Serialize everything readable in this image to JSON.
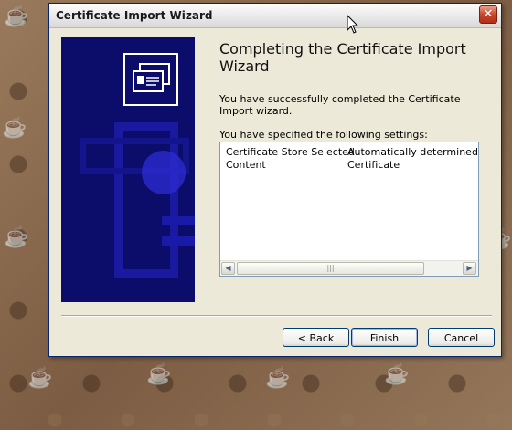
{
  "window": {
    "title": "Certificate Import Wizard",
    "close_glyph": "✕"
  },
  "wizard": {
    "heading": "Completing the Certificate Import Wizard",
    "description": "You have successfully completed the Certificate Import wizard.",
    "settings_label": "You have specified the following settings:",
    "settings": [
      {
        "key": "Certificate Store Selected",
        "value": "Automatically determined by t"
      },
      {
        "key": "Content",
        "value": "Certificate"
      }
    ],
    "scrollbar": {
      "left_glyph": "◀",
      "thumb_grip": "|||",
      "right_glyph": "▶"
    }
  },
  "buttons": {
    "back": "< Back",
    "finish": "Finish",
    "cancel": "Cancel"
  },
  "icons": {
    "wizard_banner": "certificate-icon",
    "close": "close-icon",
    "cursor": "mouse-cursor-icon"
  },
  "colors": {
    "banner": "#0c0c6a",
    "close_button": "#c8452a",
    "button_border": "#003c74"
  }
}
